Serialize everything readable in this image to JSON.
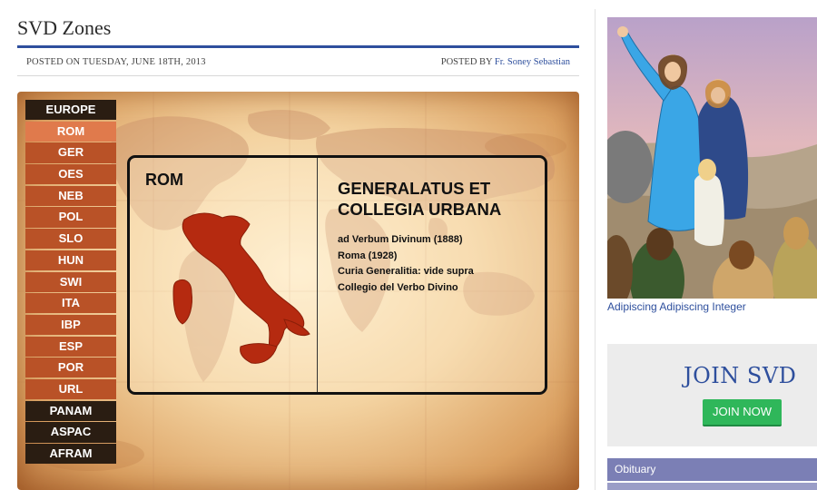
{
  "post": {
    "title": "SVD Zones",
    "posted_on": "POSTED ON TUESDAY, JUNE 18TH, 2013",
    "posted_by_label": "POSTED BY ",
    "author": "Fr. Soney Sebastian"
  },
  "zones": {
    "europe": "EUROPE",
    "sub_zones": [
      "ROM",
      "GER",
      "OES",
      "NEB",
      "POL",
      "SLO",
      "HUN",
      "SWI",
      "ITA",
      "IBP",
      "ESP",
      "POR",
      "URL"
    ],
    "active": "ROM",
    "panam": "PANAM",
    "aspac": "ASPAC",
    "afram": "AFRAM"
  },
  "zone_card": {
    "code": "ROM",
    "title_line1": "GENERALATUS ET",
    "title_line2": "COLLEGIA URBANA",
    "lines": [
      "ad Verbum Divinum (1888)",
      "Roma (1928)",
      "Curia Generalitia: vide supra",
      "Collegio del Verbo Divino"
    ]
  },
  "sidebar": {
    "image_caption": "Adipiscing Adipiscing Integer",
    "join_heading": "JOIN SVD",
    "join_button": "JOIN NOW",
    "obituary": "Obituary"
  },
  "colors": {
    "accent_blue": "#2e4f9d",
    "region_button": "#2a1d12",
    "zone_button": "#b95227",
    "zone_button_active": "#e07a4c",
    "join_green": "#2fb75a",
    "italy_red": "#b52a10"
  }
}
